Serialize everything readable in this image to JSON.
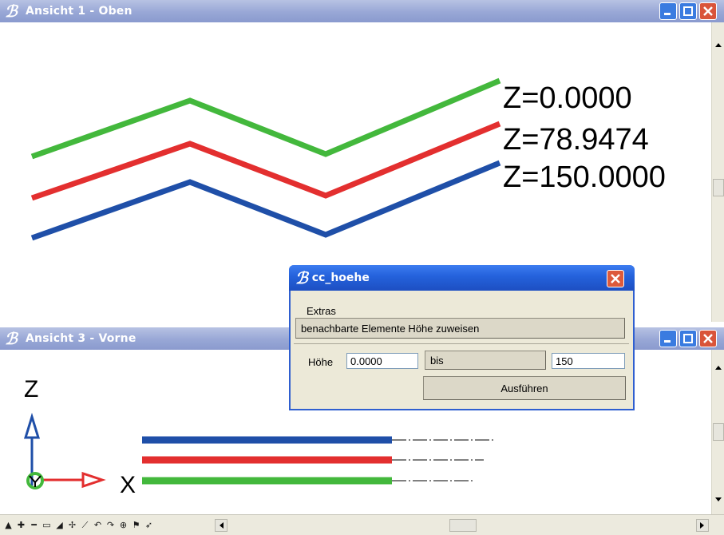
{
  "view1": {
    "title": "Ansicht 1 - Oben",
    "labels": [
      "Z=0.0000",
      "Z=78.9474",
      "Z=150.0000"
    ]
  },
  "view3": {
    "title": "Ansicht 3 - Vorne",
    "axis_z": "Z",
    "axis_x": "X"
  },
  "dialog": {
    "title": "cc_hoehe",
    "menu_extras": "Extras",
    "section_button": "benachbarte Elemente Höhe zuweisen",
    "hoehe_label": "Höhe",
    "hoehe_from": "0.0000",
    "bis_label": "bis",
    "hoehe_to": "150",
    "run_button": "Ausführen"
  },
  "colors": {
    "green": "#43b83c",
    "red": "#e32f2f",
    "blue": "#1f4fa8",
    "titlebar": "#98a7d6"
  },
  "icons": [
    "title-logo-icon",
    "minimize-icon",
    "maximize-icon",
    "close-icon",
    "scroll-up-icon",
    "scroll-down-icon",
    "scroll-left-icon",
    "scroll-right-icon"
  ]
}
